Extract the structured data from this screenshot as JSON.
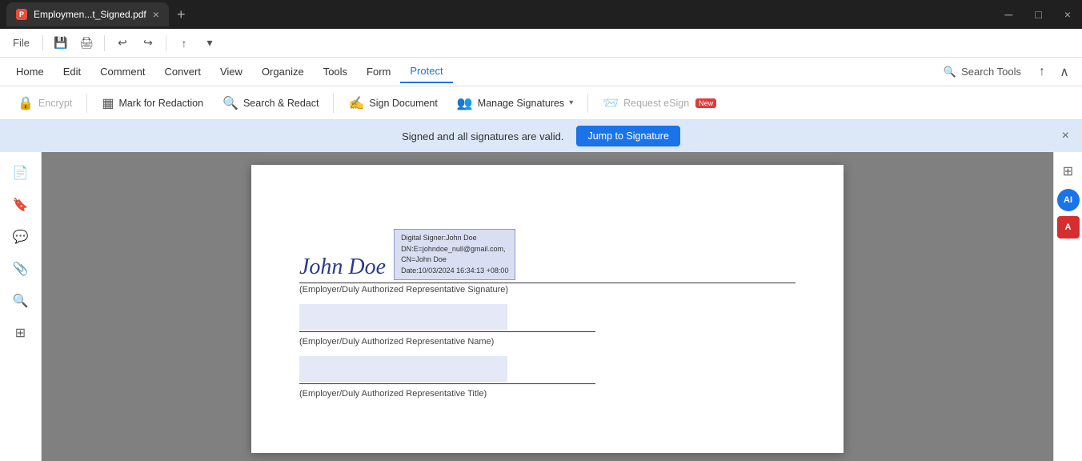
{
  "browser": {
    "tab_label": "Employmen...t_Signed.pdf",
    "close_label": "×",
    "new_tab_label": "+",
    "win_minimize": "─",
    "win_maximize": "□",
    "win_close": "×"
  },
  "toolbar": {
    "file_label": "File",
    "save_icon": "💾",
    "print_icon": "🖨",
    "undo_icon": "↩",
    "redo_icon": "↪",
    "share_icon": "↑",
    "more_icon": "▾"
  },
  "menu": {
    "items": [
      "Home",
      "Edit",
      "Comment",
      "Convert",
      "View",
      "Organize",
      "Tools",
      "Form",
      "Protect"
    ],
    "active": "Protect",
    "search_tools": "Search Tools"
  },
  "protect_ribbon": {
    "encrypt_label": "Encrypt",
    "mark_redaction_label": "Mark for Redaction",
    "search_redact_label": "Search & Redact",
    "sign_document_label": "Sign Document",
    "manage_signatures_label": "Manage Signatures",
    "request_esign_label": "Request eSign",
    "request_esign_badge": "New"
  },
  "notification": {
    "text": "Signed and all signatures are valid.",
    "jump_button": "Jump to Signature"
  },
  "sidebar": {
    "icons": [
      "📄",
      "🔖",
      "💬",
      "📎",
      "🔍",
      "⊞"
    ]
  },
  "right_sidebar": {
    "filter_icon": "⊞",
    "ai_label": "AI",
    "ms_label": "A"
  },
  "pdf": {
    "signature_name": "John Doe",
    "digital_signer": {
      "line1": "Digital Signer:John Doe",
      "line2": "DN:E=johndoe_null@gmail.com,",
      "line3": "CN=John Doe",
      "line4": "Date:10/03/2024 16:34:13 +08:00"
    },
    "sig_label": "(Employer/Duly Authorized Representative Signature)",
    "name_label": "(Employer/Duly Authorized Representative Name)",
    "title_label": "(Employer/Duly Authorized Representative Title)"
  }
}
